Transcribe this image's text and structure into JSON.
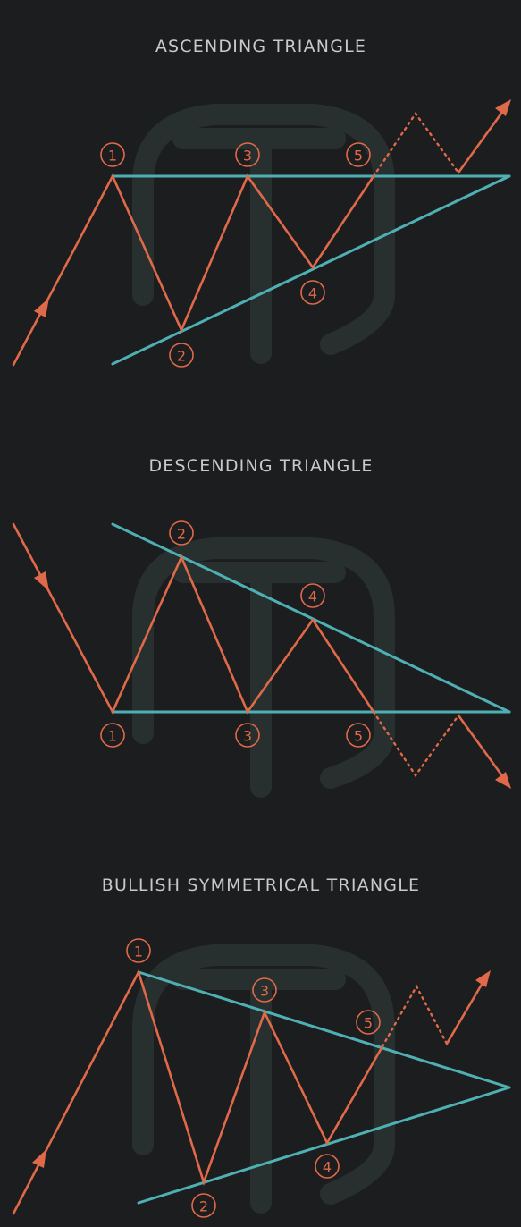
{
  "colors": {
    "background": "#1c1d1f",
    "title": "#c9c9c9",
    "wave": "#e0694a",
    "trendline": "#4fb0b4",
    "watermark": "#27302f"
  },
  "panels": [
    {
      "title": "ASCENDING TRIANGLE",
      "direction": "up",
      "point_labels": [
        "1",
        "2",
        "3",
        "4",
        "5"
      ]
    },
    {
      "title": "DESCENDING TRIANGLE",
      "direction": "down",
      "point_labels": [
        "1",
        "2",
        "3",
        "4",
        "5"
      ]
    },
    {
      "title": "BULLISH SYMMETRICAL TRIANGLE",
      "direction": "up",
      "point_labels": [
        "1",
        "2",
        "3",
        "4",
        "5"
      ]
    }
  ]
}
